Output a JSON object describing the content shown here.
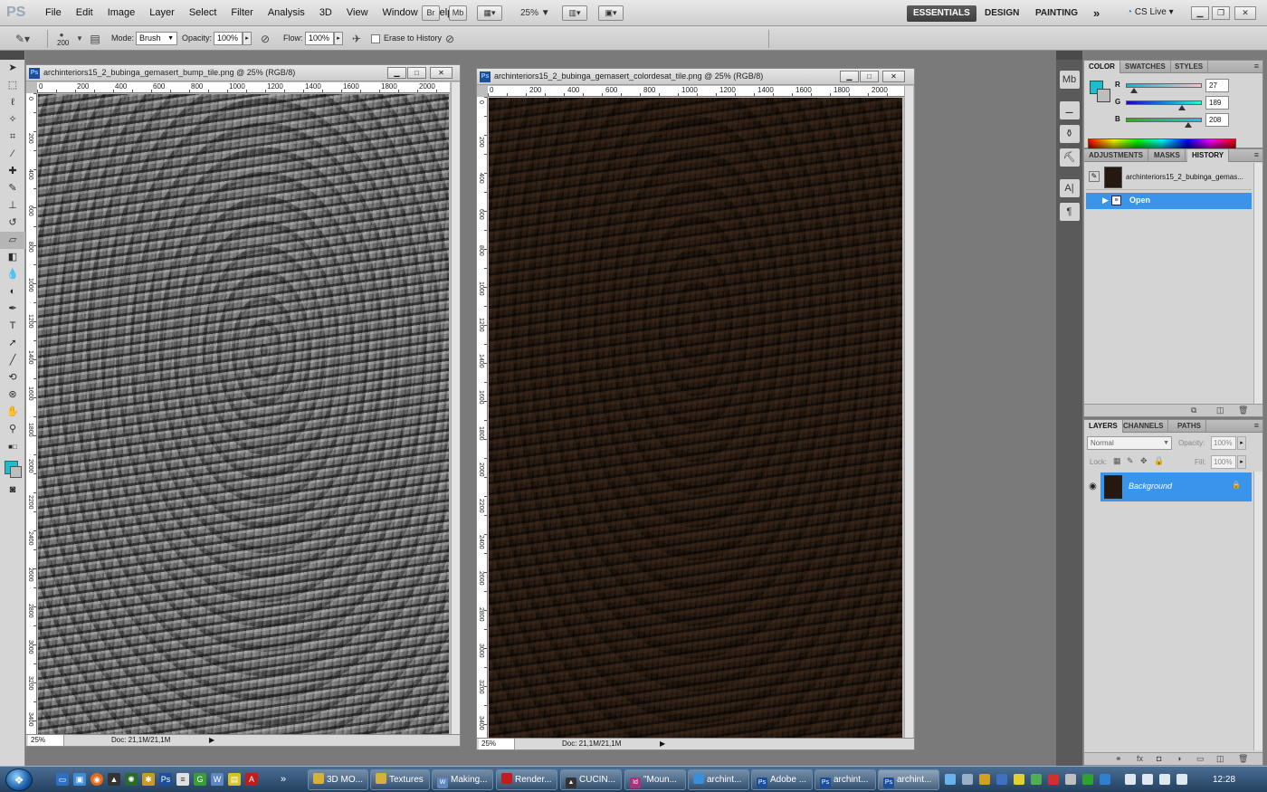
{
  "app": {
    "logo": "PS"
  },
  "menu": [
    "File",
    "Edit",
    "Image",
    "Layer",
    "Select",
    "Filter",
    "Analysis",
    "3D",
    "View",
    "Window",
    "Help"
  ],
  "appbar": {
    "bridge": "Br",
    "minibridge": "Mb",
    "zoom": "25%",
    "zoom_caret": "▼"
  },
  "workspaces": {
    "essentials": "ESSENTIALS",
    "design": "DESIGN",
    "painting": "PAINTING",
    "more": "»"
  },
  "cslive": "CS Live",
  "options": {
    "brush_size": "200",
    "mode_label": "Mode:",
    "mode_value": "Brush",
    "opacity_label": "Opacity:",
    "opacity_value": "100%",
    "flow_label": "Flow:",
    "flow_value": "100%",
    "erase_history_label": "Erase to History"
  },
  "docs": [
    {
      "title": "archinteriors15_2_bubinga_gemasert_bump_tile.png @ 25% (RGB/8)",
      "ruler_h": [
        "0",
        "200",
        "400",
        "600",
        "800",
        "1000",
        "1200",
        "1400",
        "1600",
        "1800",
        "2000"
      ],
      "ruler_v": [
        "0",
        "200",
        "400",
        "600",
        "800",
        "1000",
        "1200",
        "1400",
        "1600",
        "1800",
        "2000",
        "2200",
        "2400",
        "2600",
        "2800",
        "3000",
        "3200",
        "3400"
      ],
      "zoom": "25%",
      "info": "Doc: 21,1M/21,1M"
    },
    {
      "title": "archinteriors15_2_bubinga_gemasert_colordesat_tile.png @ 25% (RGB/8)",
      "ruler_h": [
        "0",
        "200",
        "400",
        "600",
        "800",
        "1000",
        "1200",
        "1400",
        "1600",
        "1800",
        "2000"
      ],
      "ruler_v": [
        "0",
        "200",
        "400",
        "600",
        "800",
        "1000",
        "1200",
        "1400",
        "1600",
        "1800",
        "2000",
        "2200",
        "2400",
        "2600",
        "2800",
        "3000",
        "3200",
        "3400"
      ],
      "zoom": "25%",
      "info": "Doc: 21,1M/21,1M"
    }
  ],
  "color_panel": {
    "tabs": [
      "COLOR",
      "SWATCHES",
      "STYLES"
    ],
    "r_label": "R",
    "r": "27",
    "g_label": "G",
    "g": "189",
    "b_label": "B",
    "b": "208",
    "r_level": 0.106,
    "g_level": 0.741,
    "b_level": 0.816,
    "foreground": "#1bbdd0",
    "background": "#bdbdbd"
  },
  "history_panel": {
    "tabs": [
      "ADJUSTMENTS",
      "MASKS",
      "HISTORY"
    ],
    "snapshot": "archinteriors15_2_bubinga_gemas...",
    "states": [
      "Open"
    ]
  },
  "layers_panel": {
    "tabs": [
      "LAYERS",
      "CHANNELS",
      "PATHS"
    ],
    "blend_mode": "Normal",
    "opacity_label": "Opacity:",
    "opacity": "100%",
    "lock_label": "Lock:",
    "fill_label": "Fill:",
    "fill": "100%",
    "layers": [
      "Background"
    ]
  },
  "taskbar": {
    "buttons": [
      "3D MO...",
      "Textures",
      "Making...",
      "Render...",
      "CUCIN...",
      "\"Moun...",
      "archint...",
      "Adobe ...",
      "archint...",
      "archint..."
    ],
    "ql_more": "»",
    "clock": "12:28"
  },
  "colors": {
    "accent": "#1bbdd0",
    "selection": "#3a94ea",
    "wood_dark": "#241810"
  },
  "icons": {
    "tools": [
      "move-icon",
      "marquee-icon",
      "lasso-icon",
      "quick-select-icon",
      "crop-icon",
      "eyedropper-icon",
      "spot-heal-icon",
      "brush-icon",
      "clone-stamp-icon",
      "history-brush-icon",
      "eraser-icon",
      "gradient-icon",
      "blur-icon",
      "dodge-icon",
      "pen-icon",
      "type-icon",
      "path-select-icon",
      "line-icon",
      "3d-rotate-icon",
      "3d-orbit-icon",
      "hand-icon",
      "zoom-icon"
    ]
  }
}
